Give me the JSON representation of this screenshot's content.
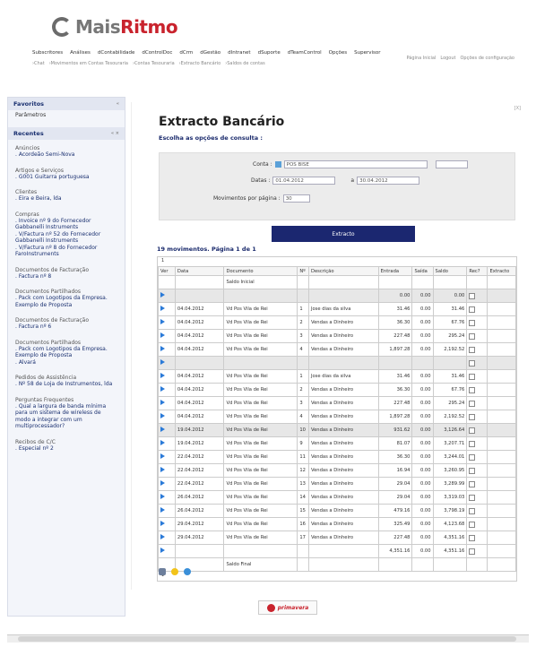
{
  "app": {
    "logo_text_a": "Mais",
    "logo_text_b": "Ritmo"
  },
  "top_nav": [
    "Subscritores",
    "Análises",
    "dContabilidade",
    "dControlDoc",
    "dCrm",
    "dGestão",
    "dIntranet",
    "dSuporte",
    "dTeamControl",
    "Opções",
    "Supervisor"
  ],
  "breadcrumb": [
    "›Chat",
    "›Movimentos em Contas Tesouraria",
    "›Contas Tesouraria",
    "›Extracto Bancário",
    "›Saldos de contas"
  ],
  "top_links": [
    "Página Inicial",
    "Logout",
    "Opções de configuração"
  ],
  "sidebar": {
    "favoritos_title": "Favoritos",
    "favoritos_item": "Parâmetros",
    "recentes_title": "Recentes",
    "groups": [
      {
        "title": "Anúncios",
        "items": [
          ". Acordeão Semi-Nova"
        ]
      },
      {
        "title": "Artigos e Serviços",
        "items": [
          ". G001 Guitarra portuguesa"
        ]
      },
      {
        "title": "Clientes",
        "items": [
          ". Eira e Beira, lda"
        ]
      },
      {
        "title": "Compras",
        "items": [
          ". Invoice nº 9 do Fornecedor Gabbanelli Instruments",
          ". V/Factura nº 52 do Fornecedor Gabbanelli Instruments",
          ". V/Factura nº 8 do Fornecedor FaroInstruments"
        ]
      },
      {
        "title": "Documentos de Facturação",
        "items": [
          ". Factura nº 8"
        ]
      },
      {
        "title": "Documentos Partilhados",
        "items": [
          ". Pack com Logotipos da Empresa.",
          "Exemplo de Proposta"
        ]
      },
      {
        "title": "Documentos de Facturação",
        "items": [
          ". Factura nº 6"
        ]
      },
      {
        "title": "Documentos Partilhados",
        "items": [
          ". Pack com Logotipos da Empresa.",
          "Exemplo de Proposta",
          ". Alvará"
        ]
      },
      {
        "title": "Pedidos de Assistência",
        "items": [
          ". Nº 58 de Loja de Instrumentos, lda"
        ]
      },
      {
        "title": "Perguntas Frequentes",
        "items": [
          ". Qual a largura de banda mínima para um sistema de wireless de modo a integrar com um multiprocessador?"
        ]
      },
      {
        "title": "Recibos de C/C",
        "items": [
          ". Especial nº 2"
        ]
      }
    ]
  },
  "main": {
    "close_label": "[X]",
    "title": "Extracto Bancário",
    "subtitle": "Escolha as opções de consulta :",
    "form": {
      "conta_label": "Conta :",
      "conta_value": "POS BISE",
      "datas_label": "Datas :",
      "date_from": "01.04.2012",
      "date_sep": "a",
      "date_to": "30.04.2012",
      "mov_label": "Movimentos por página :",
      "mov_value": "30"
    },
    "button_label": "Extracto",
    "results_title": "19 movimentos. Página 1 de 1",
    "page_num": "1",
    "columns": [
      "Ver",
      "Data",
      "Documento",
      "Nº",
      "Descrição",
      "Entrada",
      "Saída",
      "Saldo",
      "Rec?",
      "Extracto"
    ],
    "rows": [
      {
        "ver": false,
        "data": "",
        "doc": "Saldo Inicial",
        "n": "",
        "desc": "",
        "entrada": "",
        "saida": "",
        "saldo": "",
        "rec": false,
        "shade": false
      },
      {
        "ver": true,
        "data": "",
        "doc": "",
        "n": "",
        "desc": "",
        "entrada": "0.00",
        "saida": "0.00",
        "saldo": "0.00",
        "rec": true,
        "shade": true
      },
      {
        "ver": true,
        "data": "04.04.2012",
        "doc": "Vd Pos Vila de Rei",
        "n": "1",
        "desc": "Jose dias da silva",
        "entrada": "31.46",
        "saida": "0.00",
        "saldo": "31.46",
        "rec": true,
        "shade": false
      },
      {
        "ver": true,
        "data": "04.04.2012",
        "doc": "Vd Pos Vila de Rei",
        "n": "2",
        "desc": "Vendas a Dinheiro",
        "entrada": "36.30",
        "saida": "0.00",
        "saldo": "67.76",
        "rec": true,
        "shade": false
      },
      {
        "ver": true,
        "data": "04.04.2012",
        "doc": "Vd Pos Vila de Rei",
        "n": "3",
        "desc": "Vendas a Dinheiro",
        "entrada": "227.48",
        "saida": "0.00",
        "saldo": "295.24",
        "rec": true,
        "shade": false
      },
      {
        "ver": true,
        "data": "04.04.2012",
        "doc": "Vd Pos Vila de Rei",
        "n": "4",
        "desc": "Vendas a Dinheiro",
        "entrada": "1,897.28",
        "saida": "0.00",
        "saldo": "2,192.52",
        "rec": true,
        "shade": false
      },
      {
        "ver": true,
        "data": "",
        "doc": "",
        "n": "",
        "desc": "",
        "entrada": "",
        "saida": "",
        "saldo": "",
        "rec": true,
        "shade": true
      },
      {
        "ver": true,
        "data": "04.04.2012",
        "doc": "Vd Pos Vila de Rei",
        "n": "1",
        "desc": "Jose dias da silva",
        "entrada": "31.46",
        "saida": "0.00",
        "saldo": "31.46",
        "rec": true,
        "shade": false
      },
      {
        "ver": true,
        "data": "04.04.2012",
        "doc": "Vd Pos Vila de Rei",
        "n": "2",
        "desc": "Vendas a Dinheiro",
        "entrada": "36.30",
        "saida": "0.00",
        "saldo": "67.76",
        "rec": true,
        "shade": false
      },
      {
        "ver": true,
        "data": "04.04.2012",
        "doc": "Vd Pos Vila de Rei",
        "n": "3",
        "desc": "Vendas a Dinheiro",
        "entrada": "227.48",
        "saida": "0.00",
        "saldo": "295.24",
        "rec": true,
        "shade": false
      },
      {
        "ver": true,
        "data": "04.04.2012",
        "doc": "Vd Pos Vila de Rei",
        "n": "4",
        "desc": "Vendas a Dinheiro",
        "entrada": "1,897.28",
        "saida": "0.00",
        "saldo": "2,192.52",
        "rec": true,
        "shade": false
      },
      {
        "ver": true,
        "data": "19.04.2012",
        "doc": "Vd Pos Vila de Rei",
        "n": "10",
        "desc": "Vendas a Dinheiro",
        "entrada": "931.62",
        "saida": "0.00",
        "saldo": "3,126.64",
        "rec": true,
        "shade": true
      },
      {
        "ver": true,
        "data": "19.04.2012",
        "doc": "Vd Pos Vila de Rei",
        "n": "9",
        "desc": "Vendas a Dinheiro",
        "entrada": "81.07",
        "saida": "0.00",
        "saldo": "3,207.71",
        "rec": true,
        "shade": false
      },
      {
        "ver": true,
        "data": "22.04.2012",
        "doc": "Vd Pos Vila de Rei",
        "n": "11",
        "desc": "Vendas a Dinheiro",
        "entrada": "36.30",
        "saida": "0.00",
        "saldo": "3,244.01",
        "rec": true,
        "shade": false
      },
      {
        "ver": true,
        "data": "22.04.2012",
        "doc": "Vd Pos Vila de Rei",
        "n": "12",
        "desc": "Vendas a Dinheiro",
        "entrada": "16.94",
        "saida": "0.00",
        "saldo": "3,260.95",
        "rec": true,
        "shade": false
      },
      {
        "ver": true,
        "data": "22.04.2012",
        "doc": "Vd Pos Vila de Rei",
        "n": "13",
        "desc": "Vendas a Dinheiro",
        "entrada": "29.04",
        "saida": "0.00",
        "saldo": "3,289.99",
        "rec": true,
        "shade": false
      },
      {
        "ver": true,
        "data": "26.04.2012",
        "doc": "Vd Pos Vila de Rei",
        "n": "14",
        "desc": "Vendas a Dinheiro",
        "entrada": "29.04",
        "saida": "0.00",
        "saldo": "3,319.03",
        "rec": true,
        "shade": false
      },
      {
        "ver": true,
        "data": "26.04.2012",
        "doc": "Vd Pos Vila de Rei",
        "n": "15",
        "desc": "Vendas a Dinheiro",
        "entrada": "479.16",
        "saida": "0.00",
        "saldo": "3,798.19",
        "rec": true,
        "shade": false
      },
      {
        "ver": true,
        "data": "29.04.2012",
        "doc": "Vd Pos Vila de Rei",
        "n": "16",
        "desc": "Vendas a Dinheiro",
        "entrada": "325.49",
        "saida": "0.00",
        "saldo": "4,123.68",
        "rec": true,
        "shade": false
      },
      {
        "ver": true,
        "data": "29.04.2012",
        "doc": "Vd Pos Vila de Rei",
        "n": "17",
        "desc": "Vendas a Dinheiro",
        "entrada": "227.48",
        "saida": "0.00",
        "saldo": "4,351.16",
        "rec": true,
        "shade": false
      },
      {
        "ver": true,
        "data": "",
        "doc": "",
        "n": "",
        "desc": "",
        "entrada": "4,351.16",
        "saida": "0.00",
        "saldo": "4,351.16",
        "rec": true,
        "shade": false
      },
      {
        "ver": false,
        "data": "",
        "doc": "Saldo Final",
        "n": "",
        "desc": "",
        "entrada": "",
        "saida": "",
        "saldo": "",
        "rec": false,
        "shade": false
      }
    ],
    "page_num_bottom": "1"
  },
  "footer": {
    "brand": "primavera"
  },
  "colors": {
    "accent": "#1b2770",
    "brand_red": "#c9232d",
    "flag": "#2a7ad8"
  },
  "icons": {
    "row_view": "flag-icon",
    "tools": [
      "printer-icon",
      "star-icon",
      "help-icon"
    ]
  }
}
